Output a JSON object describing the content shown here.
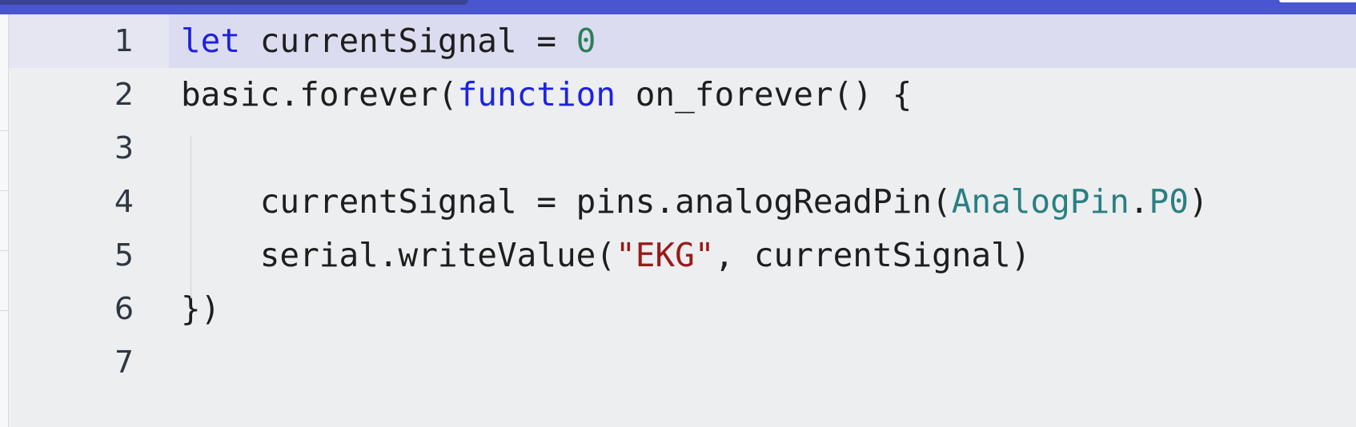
{
  "editor": {
    "lines": [
      {
        "number": "1",
        "tokens": [
          {
            "text": "let",
            "kind": "kw"
          },
          {
            "text": " currentSignal = ",
            "kind": "plain"
          },
          {
            "text": "0",
            "kind": "num"
          }
        ]
      },
      {
        "number": "2",
        "tokens": [
          {
            "text": "basic.forever(",
            "kind": "plain"
          },
          {
            "text": "function",
            "kind": "kw"
          },
          {
            "text": " on_forever() {",
            "kind": "plain"
          }
        ]
      },
      {
        "number": "3",
        "tokens": []
      },
      {
        "number": "4",
        "tokens": [
          {
            "text": "    currentSignal = pins.analogReadPin(",
            "kind": "plain"
          },
          {
            "text": "AnalogPin",
            "kind": "type"
          },
          {
            "text": ".",
            "kind": "plain"
          },
          {
            "text": "P0",
            "kind": "type"
          },
          {
            "text": ")",
            "kind": "plain"
          }
        ]
      },
      {
        "number": "5",
        "tokens": [
          {
            "text": "    serial.writeValue(",
            "kind": "plain"
          },
          {
            "text": "\"EKG\"",
            "kind": "str"
          },
          {
            "text": ", currentSignal)",
            "kind": "plain"
          }
        ]
      },
      {
        "number": "6",
        "tokens": [
          {
            "text": "})",
            "kind": "plain"
          }
        ]
      },
      {
        "number": "7",
        "tokens": []
      }
    ],
    "current_line": 1
  },
  "colors": {
    "keyword": "#1d22e0",
    "number": "#2a7f57",
    "string": "#9a1a1a",
    "type": "#2a7f82",
    "header_bar": "#4a56cf",
    "current_line_highlight": "#dcdcf0"
  }
}
